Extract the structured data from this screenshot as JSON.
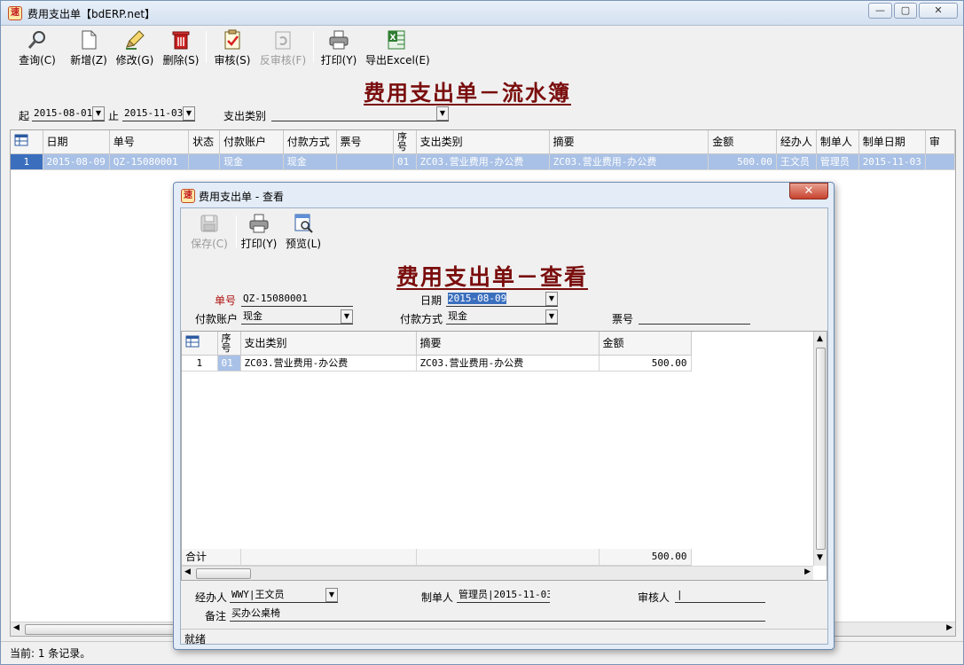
{
  "main": {
    "title": "费用支出单【bdERP.net】",
    "app_icon_glyph": "速",
    "toolbar": [
      {
        "label": "查询(C)",
        "icon": "search-icon"
      },
      {
        "label": "新增(Z)",
        "icon": "new-doc-icon"
      },
      {
        "label": "修改(G)",
        "icon": "edit-icon"
      },
      {
        "label": "删除(S)",
        "icon": "trash-icon"
      },
      {
        "label": "审核(S)",
        "icon": "approve-icon"
      },
      {
        "label": "反审核(F)",
        "icon": "unapprove-icon",
        "disabled": true
      },
      {
        "label": "打印(Y)",
        "icon": "printer-icon"
      },
      {
        "label": "导出Excel(E)",
        "icon": "excel-icon"
      }
    ],
    "report_title": "费用支出单－流水簿",
    "filter": {
      "from_label": "起",
      "from_value": "2015-08-01",
      "to_label": "止",
      "to_value": "2015-11-03",
      "category_label": "支出类别",
      "category_value": ""
    },
    "grid": {
      "columns": [
        "日期",
        "单号",
        "状态",
        "付款账户",
        "付款方式",
        "票号",
        "序号",
        "支出类别",
        "摘要",
        "金额",
        "经办人",
        "制单人",
        "制单日期",
        "审"
      ],
      "rows": [
        {
          "no": "1",
          "date": "2015-08-09",
          "doc": "QZ-15080001",
          "status": "",
          "account": "现金",
          "method": "现金",
          "ticket": "",
          "seq": "01",
          "category": "ZC03.营业费用-办公费",
          "summary": "ZC03.营业费用-办公费",
          "amount": "500.00",
          "handler": "王文员",
          "maker": "管理员",
          "make_date": "2015-11-03",
          "audit": ""
        }
      ]
    },
    "status": "当前: 1 条记录。"
  },
  "dialog": {
    "title": "费用支出单 - 查看",
    "app_icon_glyph": "速",
    "toolbar": [
      {
        "label": "保存(C)",
        "icon": "save-icon",
        "disabled": true
      },
      {
        "label": "打印(Y)",
        "icon": "printer-icon"
      },
      {
        "label": "预览(L)",
        "icon": "preview-icon"
      }
    ],
    "report_title": "费用支出单－查看",
    "fields": {
      "doc_label": "单号",
      "doc_value": "QZ-15080001",
      "date_label": "日期",
      "date_value": "2015-08-09",
      "account_label": "付款账户",
      "account_value": "现金",
      "method_label": "付款方式",
      "method_value": "现金",
      "ticket_label": "票号",
      "ticket_value": ""
    },
    "grid": {
      "columns": [
        "序号",
        "支出类别",
        "摘要",
        "金额"
      ],
      "rows": [
        {
          "no": "1",
          "seq": "01",
          "category": "ZC03.营业费用-办公费",
          "summary": "ZC03.营业费用-办公费",
          "amount": "500.00"
        }
      ],
      "total_label": "合计",
      "total_amount": "500.00"
    },
    "footer": {
      "handler_label": "经办人",
      "handler_value": "WWY|王文员",
      "maker_label": "制单人",
      "maker_value": "管理员|2015-11-03",
      "auditor_label": "审核人",
      "auditor_value": "|",
      "note_label": "备注",
      "note_value": "买办公桌椅"
    },
    "status": "就绪"
  },
  "colors": {
    "title_red": "#7a0d0d",
    "selection": "#a9c1e6",
    "selection_dark": "#3b6fbe"
  }
}
